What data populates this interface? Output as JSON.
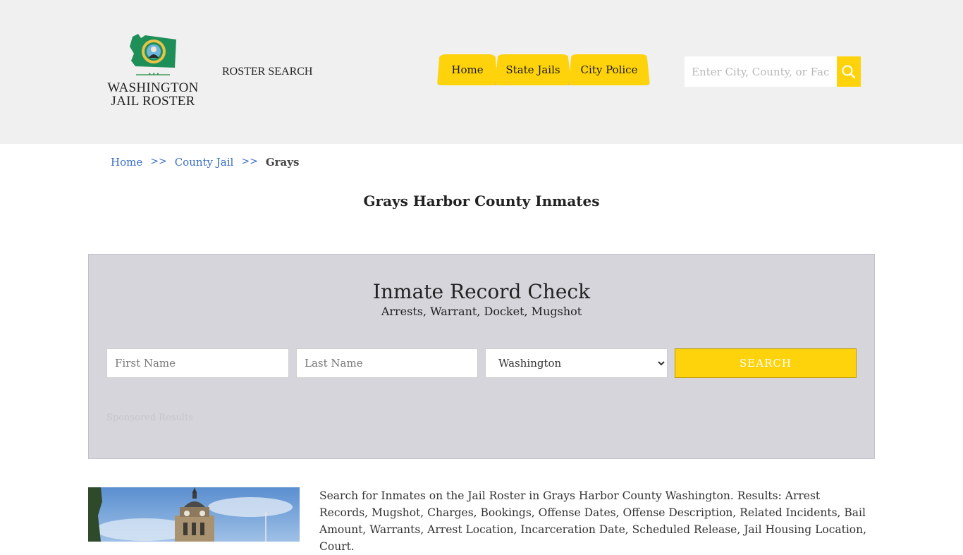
{
  "header": {
    "logo": {
      "line1": "WASHINGTON",
      "line2": "JAIL ROSTER",
      "emblem": "washington-state-seal-icon"
    },
    "roster_search_label": "ROSTER SEARCH",
    "nav": [
      {
        "label": "Home"
      },
      {
        "label": "State Jails"
      },
      {
        "label": "City Police"
      }
    ],
    "search": {
      "placeholder": "Enter City, County, or Facility",
      "value": "",
      "icon": "search-icon"
    }
  },
  "breadcrumb": {
    "items": [
      {
        "label": "Home"
      },
      {
        "label": "County Jail"
      }
    ],
    "separator": ">>",
    "current": "Grays"
  },
  "page_title": "Grays Harbor County Inmates",
  "record_check": {
    "title": "Inmate Record Check",
    "subtitle": "Arrests, Warrant, Docket, Mugshot",
    "first_name_placeholder": "First Name",
    "last_name_placeholder": "Last Name",
    "state_selected": "Washington",
    "search_label": "SEARCH",
    "sponsored_label": "Sponsored Results"
  },
  "description": "Search for Inmates on the Jail Roster in Grays Harbor County Washington. Results: Arrest Records, Mugshot, Charges, Bookings, Offense Dates, Offense Description, Related Incidents, Bail Amount, Warrants, Arrest Location, Incarceration Date, Scheduled Release, Jail Housing Location, Court.",
  "colors": {
    "accent_yellow": "#ffd30b",
    "header_bg": "#f0f0f0",
    "panel_bg": "#d6d5db",
    "link_blue": "#3a6fc4",
    "logo_green": "#1f8f5a"
  }
}
